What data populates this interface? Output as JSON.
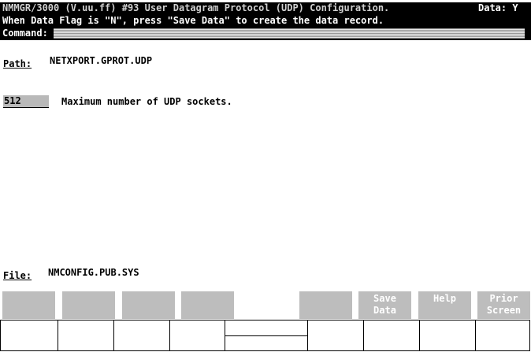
{
  "header": {
    "title": "NMMGR/3000 (V.uu.ff) #93 User Datagram Protocol (UDP) Configuration.",
    "data_flag": "Data: Y",
    "message": "When Data Flag is \"N\", press \"Save Data\" to create the data record.",
    "command_label": "Command:",
    "command_value": ""
  },
  "path": {
    "label": "Path:",
    "value": "NETXPORT.GPROT.UDP"
  },
  "fields": [
    {
      "value": "512 ",
      "description": "Maximum number of UDP sockets."
    }
  ],
  "file": {
    "label": "File:",
    "value": "NMCONFIG.PUB.SYS"
  },
  "function_keys": [
    {
      "line1": "",
      "line2": ""
    },
    {
      "line1": "",
      "line2": ""
    },
    {
      "line1": "",
      "line2": ""
    },
    {
      "line1": "",
      "line2": ""
    },
    {
      "line1": "",
      "line2": ""
    },
    {
      "line1": "Save",
      "line2": "Data"
    },
    {
      "line1": "Help",
      "line2": ""
    },
    {
      "line1": "Prior",
      "line2": "Screen"
    }
  ]
}
